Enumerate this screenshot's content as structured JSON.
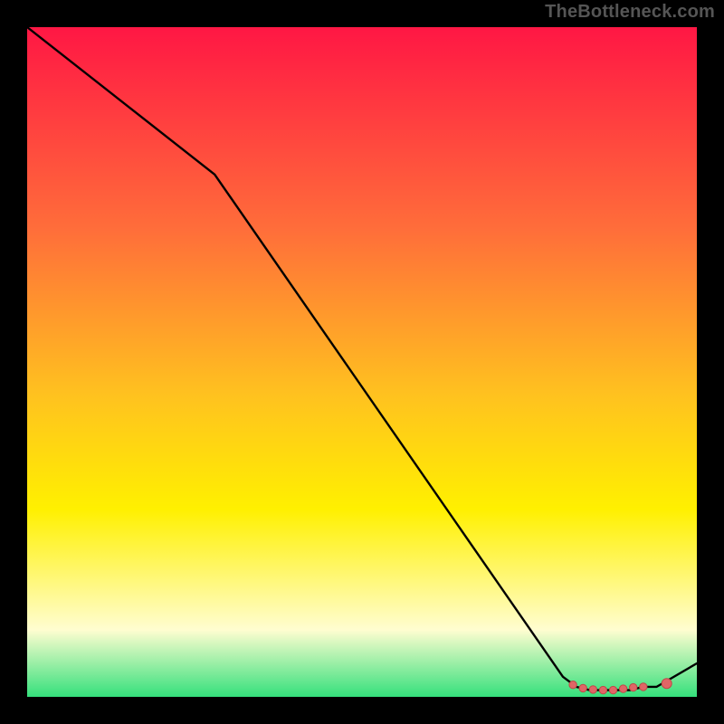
{
  "watermark": "TheBottleneck.com",
  "colors": {
    "frame": "#000000",
    "watermark": "#555555",
    "gradient_top": "#ff1744",
    "gradient_mid1": "#ff6d3a",
    "gradient_mid2": "#ffc21f",
    "gradient_mid3": "#fff000",
    "gradient_mid4": "#fffdd0",
    "gradient_bottom": "#35e07c",
    "line": "#000000",
    "marker_fill": "#e06666",
    "marker_stroke": "#c04848"
  },
  "chart_data": {
    "type": "line",
    "title": "",
    "xlabel": "",
    "ylabel": "",
    "xlim": [
      0,
      100
    ],
    "ylim": [
      0,
      100
    ],
    "series": [
      {
        "name": "bottleneck-curve",
        "x": [
          0,
          28,
          80,
          82,
          84,
          86,
          88,
          90,
          92,
          94,
          100
        ],
        "values": [
          100,
          78,
          3,
          1.5,
          1,
          1,
          1,
          1,
          1.5,
          1.5,
          5
        ]
      }
    ],
    "markers": [
      {
        "name": "flat-segment-dot",
        "x": 81.5,
        "y": 1.8
      },
      {
        "name": "flat-segment-dot",
        "x": 83.0,
        "y": 1.3
      },
      {
        "name": "flat-segment-dot",
        "x": 84.5,
        "y": 1.1
      },
      {
        "name": "flat-segment-dot",
        "x": 86.0,
        "y": 1.0
      },
      {
        "name": "flat-segment-dot",
        "x": 87.5,
        "y": 1.0
      },
      {
        "name": "flat-segment-dot",
        "x": 89.0,
        "y": 1.2
      },
      {
        "name": "flat-segment-dot",
        "x": 90.5,
        "y": 1.4
      },
      {
        "name": "flat-segment-dot",
        "x": 92.0,
        "y": 1.5
      },
      {
        "name": "flat-segment-end",
        "x": 95.5,
        "y": 2.0
      }
    ]
  }
}
